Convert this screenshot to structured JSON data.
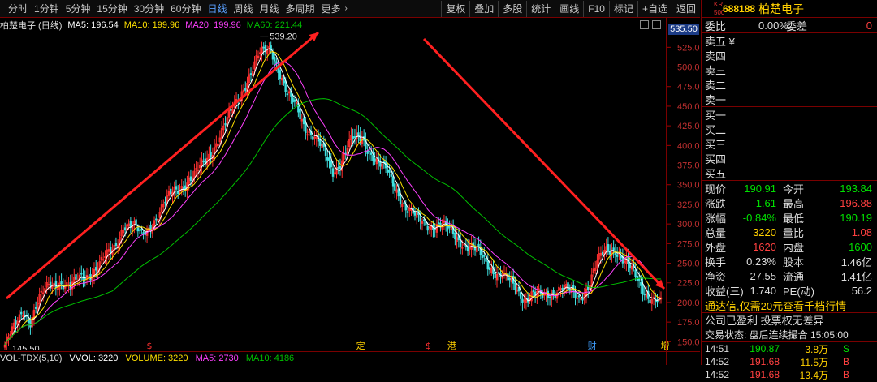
{
  "periods": [
    "分时",
    "1分钟",
    "5分钟",
    "15分钟",
    "30分钟",
    "60分钟",
    "日线",
    "周线",
    "月线",
    "多周期",
    "更多"
  ],
  "active_period": "日线",
  "tools": [
    "复权",
    "叠加",
    "多股",
    "统计",
    "画线",
    "F10",
    "标记",
    "+自选",
    "返回"
  ],
  "legend": {
    "title": "柏楚电子 (日线)",
    "ma5_label": "MA5: 196.54",
    "ma10_label": "MA10: 199.96",
    "ma20_label": "MA20: 199.96",
    "ma60_label": "MA60: 221.44"
  },
  "current_price_tag": "535.50",
  "chart_data": {
    "type": "candlestick",
    "y_ticks": [
      "525.0",
      "500.0",
      "475.0",
      "450.0",
      "425.0",
      "400.0",
      "375.0",
      "350.0",
      "325.0",
      "300.0",
      "275.0",
      "250.0",
      "225.0",
      "200.0",
      "175.0",
      "150.0"
    ],
    "ylim": [
      139,
      546
    ],
    "high_label": "539.20",
    "low_label": "145.50",
    "colors": {
      "up": "#ff3030",
      "down": "#40e0e0",
      "ma5": "#ffffff",
      "ma10": "#ffe000",
      "ma20": "#ff40ff",
      "ma60": "#00c000"
    },
    "close_path": [
      [
        0,
        146
      ],
      [
        5,
        165
      ],
      [
        10,
        190
      ],
      [
        14,
        178
      ],
      [
        18,
        200
      ],
      [
        24,
        220
      ],
      [
        30,
        228
      ],
      [
        36,
        218
      ],
      [
        42,
        232
      ],
      [
        48,
        240
      ],
      [
        54,
        252
      ],
      [
        60,
        270
      ],
      [
        65,
        300
      ],
      [
        70,
        296
      ],
      [
        75,
        285
      ],
      [
        80,
        300
      ],
      [
        86,
        318
      ],
      [
        92,
        340
      ],
      [
        98,
        352
      ],
      [
        104,
        360
      ],
      [
        110,
        380
      ],
      [
        116,
        405
      ],
      [
        122,
        430
      ],
      [
        128,
        460
      ],
      [
        134,
        490
      ],
      [
        140,
        515
      ],
      [
        146,
        525
      ],
      [
        150,
        500
      ],
      [
        155,
        462
      ],
      [
        160,
        448
      ],
      [
        165,
        425
      ],
      [
        170,
        410
      ],
      [
        175,
        390
      ],
      [
        180,
        368
      ],
      [
        185,
        383
      ],
      [
        190,
        405
      ],
      [
        196,
        410
      ],
      [
        200,
        395
      ],
      [
        205,
        375
      ],
      [
        210,
        365
      ],
      [
        215,
        345
      ],
      [
        220,
        320
      ],
      [
        225,
        308
      ],
      [
        230,
        302
      ],
      [
        235,
        300
      ],
      [
        240,
        296
      ],
      [
        245,
        290
      ],
      [
        250,
        280
      ],
      [
        255,
        270
      ],
      [
        260,
        262
      ],
      [
        265,
        250
      ],
      [
        270,
        238
      ],
      [
        275,
        228
      ],
      [
        280,
        220
      ],
      [
        285,
        206
      ],
      [
        290,
        210
      ],
      [
        295,
        206
      ],
      [
        300,
        214
      ],
      [
        305,
        220
      ],
      [
        310,
        212
      ],
      [
        315,
        205
      ],
      [
        320,
        223
      ],
      [
        325,
        250
      ],
      [
        330,
        265
      ],
      [
        335,
        270
      ],
      [
        340,
        252
      ],
      [
        345,
        235
      ],
      [
        350,
        218
      ],
      [
        355,
        206
      ],
      [
        360,
        198
      ]
    ],
    "x_markers": [
      {
        "label": "$",
        "xi": 80,
        "color": "#ff3030"
      },
      {
        "label": "定",
        "xi": 195,
        "color": "#ffd000"
      },
      {
        "label": "$",
        "xi": 233,
        "color": "#ff3030"
      },
      {
        "label": "港",
        "xi": 245,
        "color": "#ffd000"
      },
      {
        "label": "财",
        "xi": 322,
        "color": "#40a0ff"
      },
      {
        "label": "增",
        "xi": 362,
        "color": "#ffd000"
      }
    ]
  },
  "volume_bar": {
    "label": "VOL-TDX(5,10)",
    "vvol": "VVOL: 3220",
    "volume": "VOLUME: 3220",
    "ma5": "MA5: 2730",
    "ma10": "MA10: 4186"
  },
  "panel": {
    "market": "KR 500",
    "code": "688188",
    "name": "柏楚电子",
    "weibi_label": "委比",
    "weibi_value": "0.00%",
    "weicha_label": "委差",
    "weicha_value": "0",
    "sell": [
      "卖五 ¥",
      "卖四",
      "卖三",
      "卖二",
      "卖一"
    ],
    "buy": [
      "买一",
      "买二",
      "买三",
      "买四",
      "买五"
    ],
    "quote": [
      {
        "l1": "现价",
        "v1": "190.91",
        "c1": "c-grn",
        "l2": "今开",
        "v2": "193.84",
        "c2": "c-grn"
      },
      {
        "l1": "涨跌",
        "v1": "-1.61",
        "c1": "c-grn",
        "l2": "最高",
        "v2": "196.88",
        "c2": "c-red"
      },
      {
        "l1": "涨幅",
        "v1": "-0.84%",
        "c1": "c-grn",
        "l2": "最低",
        "v2": "190.19",
        "c2": "c-grn"
      },
      {
        "l1": "总量",
        "v1": "3220",
        "c1": "c-yel",
        "l2": "量比",
        "v2": "1.08",
        "c2": "c-red"
      },
      {
        "l1": "外盘",
        "v1": "1620",
        "c1": "c-red",
        "l2": "内盘",
        "v2": "1600",
        "c2": "c-grn"
      },
      {
        "l1": "换手",
        "v1": "0.23%",
        "c1": "c-wht",
        "l2": "股本",
        "v2": "1.46亿",
        "c2": "c-wht"
      },
      {
        "l1": "净资",
        "v1": "27.55",
        "c1": "c-wht",
        "l2": "流通",
        "v2": "1.41亿",
        "c2": "c-wht"
      },
      {
        "l1": "收益(三)",
        "v1": "1.740",
        "c1": "c-wht",
        "l2": "PE(动)",
        "v2": "56.2",
        "c2": "c-wht"
      }
    ],
    "promo": "通达信,仅需20元查看千档行情",
    "info1": "公司已盈利 投票权无差异",
    "info2": "交易状态: 盘后连续撮合 15:05:00",
    "ticks": [
      {
        "t": "14:51",
        "p": "190.87",
        "v": "3.8万",
        "d": "S"
      },
      {
        "t": "14:52",
        "p": "191.68",
        "v": "11.5万",
        "d": "B"
      },
      {
        "t": "14:52",
        "p": "191.68",
        "v": "13.4万",
        "d": "B"
      }
    ]
  }
}
